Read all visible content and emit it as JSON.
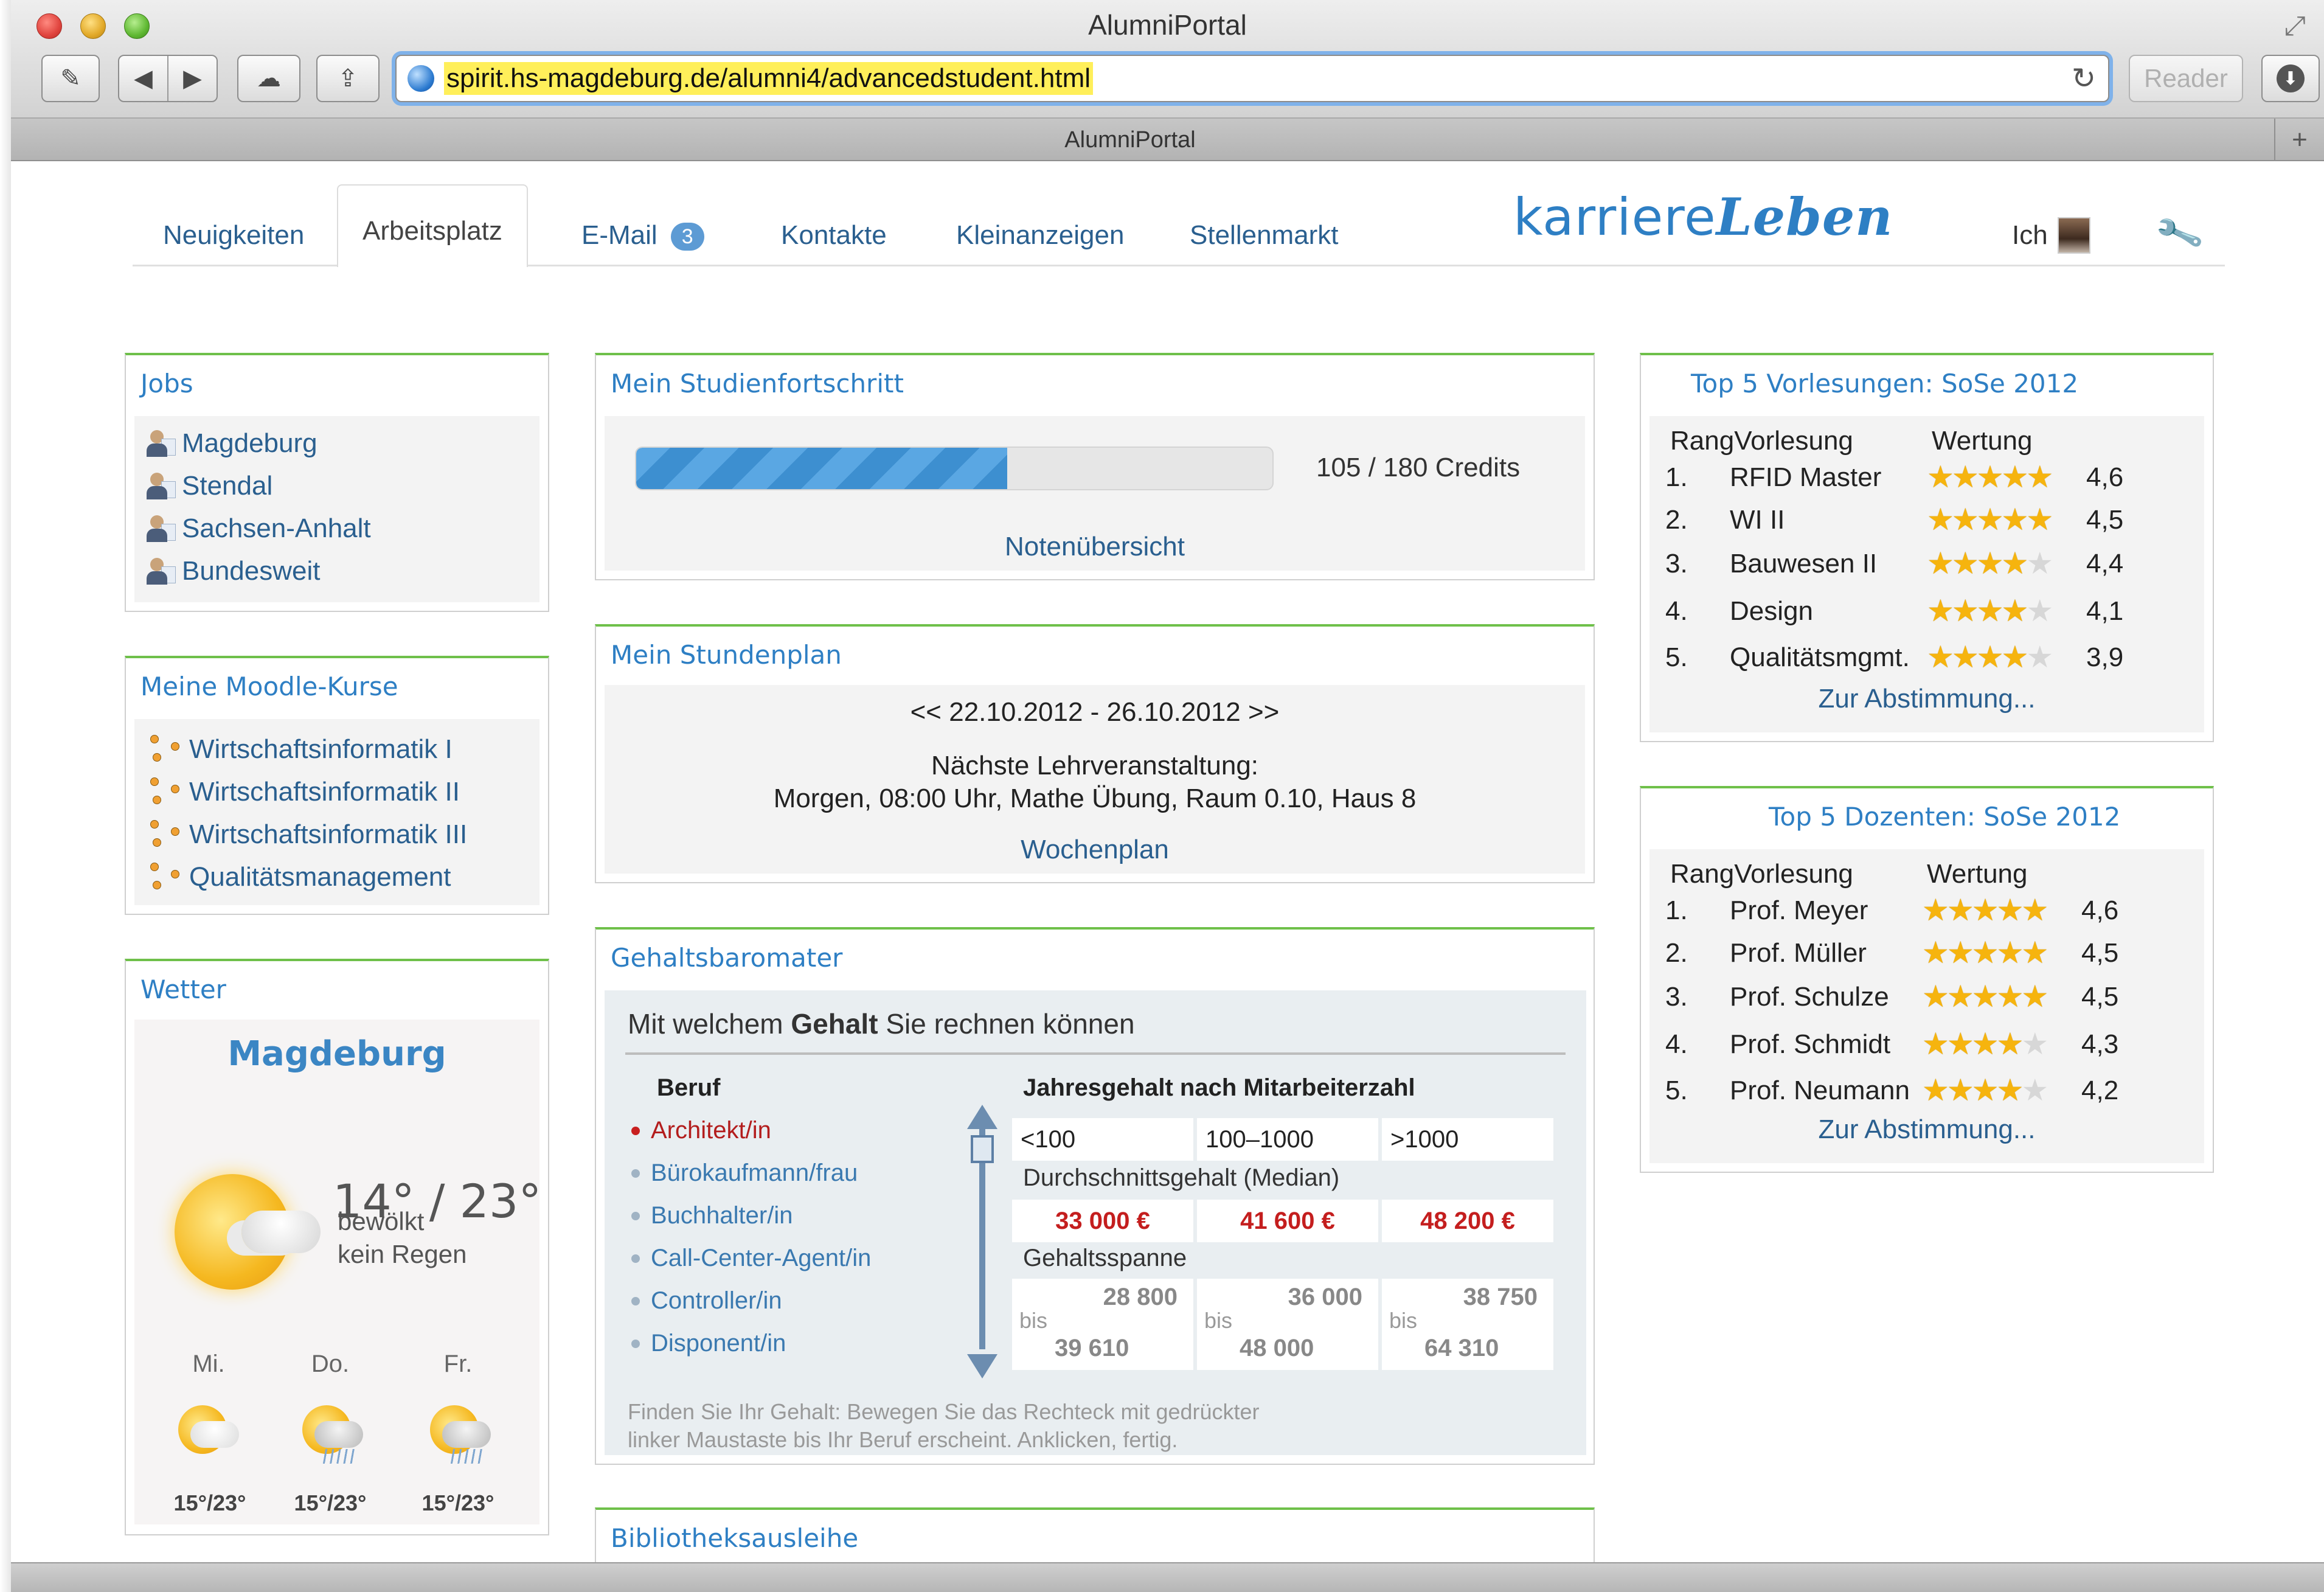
{
  "window": {
    "title": "AlumniPortal",
    "tab_title": "AlumniPortal",
    "url": "spirit.hs-magdeburg.de/alumni4/advancedstudent.html",
    "reader_label": "Reader",
    "newtab_label": "+"
  },
  "nav": {
    "items": [
      "Neuigkeiten",
      "Arbeitsplatz",
      "E-Mail",
      "Kontakte",
      "Kleinanzeigen",
      "Stellenmarkt"
    ],
    "email_badge": "3",
    "brand_light": "karriere",
    "brand_bold": "Leben",
    "me_label": "Ich"
  },
  "jobs": {
    "title": "Jobs",
    "items": [
      "Magdeburg",
      "Stendal",
      "Sachsen-Anhalt",
      "Bundesweit"
    ]
  },
  "moodle": {
    "title": "Meine Moodle-Kurse",
    "items": [
      "Wirtschaftsinformatik I",
      "Wirtschaftsinformatik II",
      "Wirtschaftsinformatik III",
      "Qualitätsmanagement"
    ]
  },
  "weather": {
    "title": "Wetter",
    "city": "Magdeburg",
    "temp": "14° / 23°",
    "desc1": "bewölkt",
    "desc2": "kein Regen",
    "days": [
      {
        "label": "Mi.",
        "temp": "15°/23°"
      },
      {
        "label": "Do.",
        "temp": "15°/23°"
      },
      {
        "label": "Fr.",
        "temp": "15°/23°"
      }
    ]
  },
  "progress": {
    "title": "Mein Studienfortschritt",
    "credits": 105,
    "total": 180,
    "label": "105 / 180 Credits",
    "link": "Notenübersicht"
  },
  "timetable": {
    "title": "Mein Stundenplan",
    "range": "<< 22.10.2012 - 26.10.2012 >>",
    "next_label": "Nächste Lehrveranstaltung:",
    "next_value": "Morgen, 08:00 Uhr, Mathe Übung, Raum 0.10, Haus 8",
    "link": "Wochenplan"
  },
  "salary": {
    "title": "Gehaltsbaromater",
    "headline_pre": "Mit welchem ",
    "headline_bold": "Gehalt",
    "headline_post": " Sie rechnen können",
    "col_job": "Beruf",
    "col_salary": "Jahresgehalt nach Mitarbeiterzahl",
    "jobs": [
      "Architekt/in",
      "Bürokaufmann/frau",
      "Buchhalter/in",
      "Call-Center-Agent/in",
      "Controller/in",
      "Disponent/in"
    ],
    "sizes": [
      "<100",
      "100–1000",
      ">1000"
    ],
    "median_label": "Durchschnittsgehalt (Median)",
    "medians": [
      "33 000 €",
      "41 600 €",
      "48 200 €"
    ],
    "range_label": "Gehaltsspanne",
    "bis_label": "bis",
    "ranges": [
      {
        "from": "28 800",
        "to": "39 610"
      },
      {
        "from": "36 000",
        "to": "48 000"
      },
      {
        "from": "38 750",
        "to": "64 310"
      }
    ],
    "hint1": "Finden Sie Ihr Gehalt: Bewegen Sie das Rechteck mit gedrückter",
    "hint2": "linker Maustaste bis Ihr Beruf erscheint. Anklicken, fertig."
  },
  "top_lectures": {
    "title": "Top 5 Vorlesungen: SoSe 2012",
    "col_rank": "RangVorlesung",
    "col_rating": "Wertung",
    "rows": [
      {
        "num": "1.",
        "name": "RFID Master",
        "stars": 5,
        "score": "4,6"
      },
      {
        "num": "2.",
        "name": "WI II",
        "stars": 5,
        "score": "4,5"
      },
      {
        "num": "3.",
        "name": "Bauwesen II",
        "stars": 4,
        "score": "4,4"
      },
      {
        "num": "4.",
        "name": "Design",
        "stars": 4,
        "score": "4,1"
      },
      {
        "num": "5.",
        "name": "Qualitätsmgmt.",
        "stars": 4,
        "score": "3,9"
      }
    ],
    "link": "Zur Abstimmung..."
  },
  "top_lecturers": {
    "title": "Top 5 Dozenten: SoSe 2012",
    "col_rank": "RangVorlesung",
    "col_rating": "Wertung",
    "rows": [
      {
        "num": "1.",
        "name": "Prof. Meyer",
        "stars": 5,
        "score": "4,6"
      },
      {
        "num": "2.",
        "name": "Prof. Müller",
        "stars": 5,
        "score": "4,5"
      },
      {
        "num": "3.",
        "name": "Prof. Schulze",
        "stars": 5,
        "score": "4,5"
      },
      {
        "num": "4.",
        "name": "Prof. Schmidt",
        "stars": 4,
        "score": "4,3"
      },
      {
        "num": "5.",
        "name": "Prof. Neumann",
        "stars": 4,
        "score": "4,2"
      }
    ],
    "link": "Zur Abstimmung..."
  },
  "library": {
    "title": "Bibliotheksausleihe"
  },
  "colors": {
    "accent_green": "#6fc04a",
    "link_blue": "#2e7fc4",
    "salary_red": "#c41e1e"
  }
}
